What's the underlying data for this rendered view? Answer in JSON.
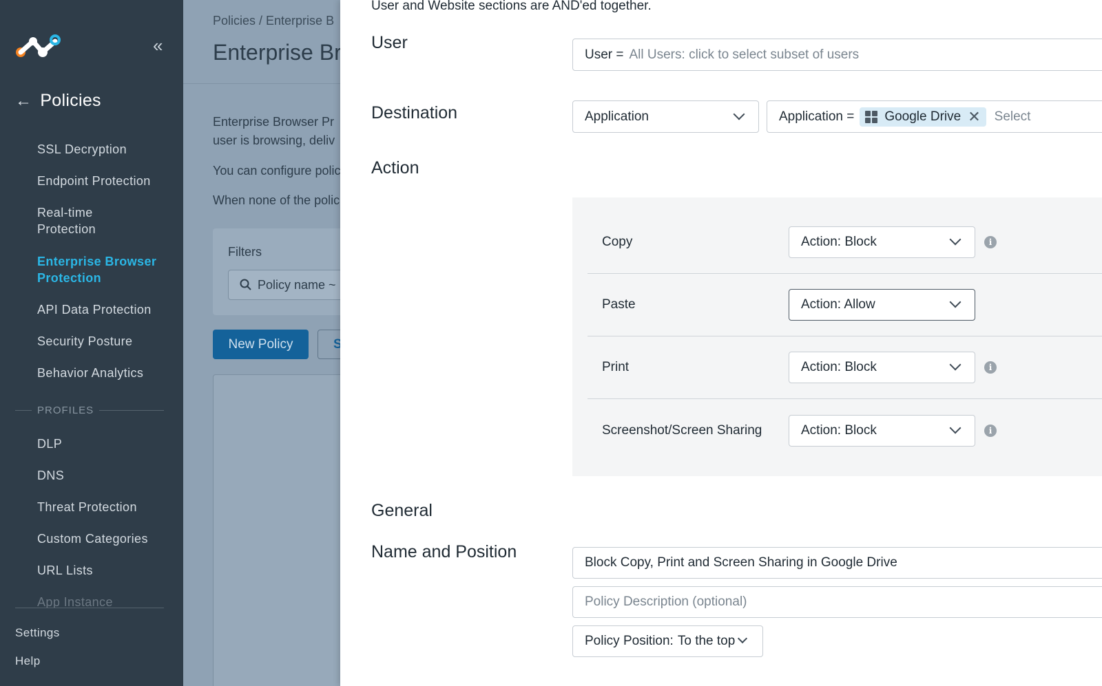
{
  "sidebar": {
    "section_title": "Policies",
    "items": [
      {
        "label": "SSL Decryption"
      },
      {
        "label": "Endpoint Protection"
      },
      {
        "label": "Real-time\nProtection"
      },
      {
        "label": "Enterprise Browser\nProtection",
        "active": true
      },
      {
        "label": "API Data Protection"
      },
      {
        "label": "Security Posture"
      },
      {
        "label": "Behavior Analytics"
      }
    ],
    "profiles_heading": "PROFILES",
    "profile_items": [
      {
        "label": "DLP"
      },
      {
        "label": "DNS"
      },
      {
        "label": "Threat Protection"
      },
      {
        "label": "Custom Categories"
      },
      {
        "label": "URL Lists"
      },
      {
        "label": "App Instance"
      }
    ],
    "bottom": {
      "settings": "Settings",
      "help": "Help"
    },
    "colors": {
      "background": "#2f3d49",
      "active": "#2bb7e6"
    }
  },
  "background_page": {
    "breadcrumb": "Policies / Enterprise B",
    "title": "Enterprise Br",
    "text_line1": "Enterprise Browser Pr",
    "text_line2": "user is browsing, deliv",
    "text_line3": "You can configure polic",
    "text_line4": "When none of the polic",
    "filters_label": "Filters",
    "filter_input": "Policy name ~",
    "new_policy_button": "New Policy",
    "secondary_button": "S"
  },
  "panel": {
    "note": "User and Website sections are AND'ed together.",
    "user": {
      "label": "User",
      "field_prefix": "User =",
      "field_value": "All Users: click to select subset of users"
    },
    "destination": {
      "label": "Destination",
      "type_select": "Application",
      "field_prefix": "Application =",
      "chip": "Google Drive",
      "select_placeholder": "Select"
    },
    "action": {
      "label": "Action",
      "rows": [
        {
          "label": "Copy",
          "value": "Action: Block",
          "info": true
        },
        {
          "label": "Paste",
          "value": "Action: Allow",
          "info": false
        },
        {
          "label": "Print",
          "value": "Action: Block",
          "info": true
        },
        {
          "label": "Screenshot/Screen Sharing",
          "value": "Action: Block",
          "info": true
        }
      ]
    },
    "general": {
      "label": "General",
      "name_position_label": "Name and Position",
      "policy_name": "Block Copy, Print and Screen Sharing in Google  Drive",
      "description_placeholder": "Policy Description (optional)",
      "position_prefix": "Policy Position:",
      "position_value": "To the top"
    }
  },
  "icons": [
    "logo-icon",
    "collapse-icon",
    "back-arrow-icon",
    "search-icon",
    "chevron-down-icon",
    "app-grid-icon",
    "close-icon",
    "info-icon"
  ]
}
